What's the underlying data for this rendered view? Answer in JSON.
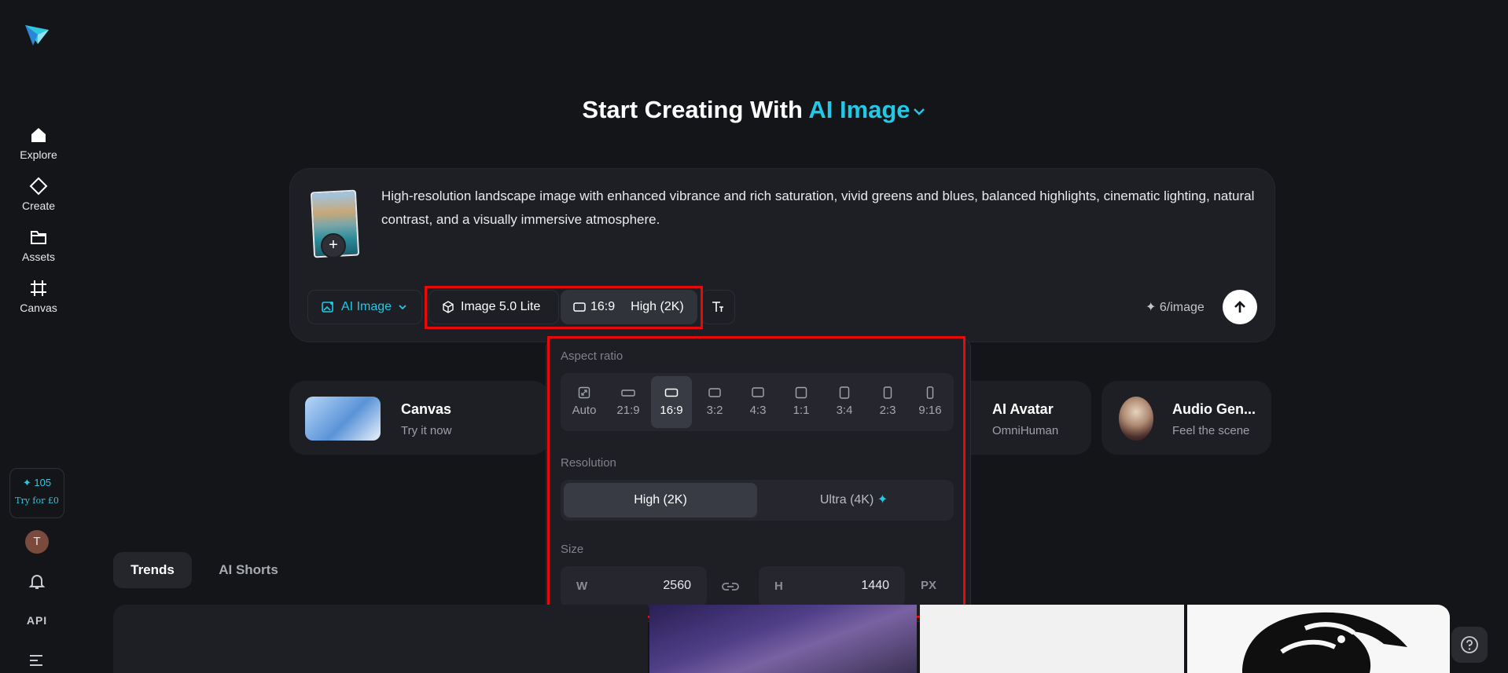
{
  "sidebar": {
    "nav": [
      {
        "label": "Explore",
        "icon": "home-icon"
      },
      {
        "label": "Create",
        "icon": "diamond-icon"
      },
      {
        "label": "Assets",
        "icon": "folder-icon"
      },
      {
        "label": "Canvas",
        "icon": "frame-icon"
      }
    ],
    "credits": "✦ 105",
    "trial": "Try for £0",
    "avatar_initial": "T",
    "api_label": "API"
  },
  "headline": {
    "prefix": "Start Creating With",
    "accent": "AI Image"
  },
  "prompt": {
    "text": "High-resolution landscape image with enhanced vibrance and rich saturation, vivid greens and blues, balanced highlights, cinematic lighting, natural contrast, and a visually immersive atmosphere.",
    "mode_label": "AI Image",
    "model_label": "Image 5.0 Lite",
    "ratio_label": "16:9",
    "quality_label": "High (2K)",
    "cost": "✦ 6/image"
  },
  "features": [
    {
      "title": "Canvas",
      "subtitle": "Try it now"
    },
    {
      "title": "AI Avatar",
      "subtitle": "OmniHuman"
    },
    {
      "title": "Audio Gen...",
      "subtitle": "Feel the scene"
    }
  ],
  "panel": {
    "aspect_label": "Aspect ratio",
    "ratios": [
      "Auto",
      "21:9",
      "16:9",
      "3:2",
      "4:3",
      "1:1",
      "3:4",
      "2:3",
      "9:16"
    ],
    "selected_ratio": "16:9",
    "resolution_label": "Resolution",
    "res_high": "High (2K)",
    "res_ultra": "Ultra (4K)",
    "size_label": "Size",
    "w_label": "W",
    "w_value": "2560",
    "h_label": "H",
    "h_value": "1440",
    "unit": "PX"
  },
  "tabs": [
    {
      "label": "Trends",
      "active": true
    },
    {
      "label": "AI Shorts",
      "active": false
    }
  ],
  "colors": {
    "accent": "#22c8e6",
    "background": "#141519",
    "card": "#1e1f25",
    "highlight_box": "#e60a0a"
  }
}
